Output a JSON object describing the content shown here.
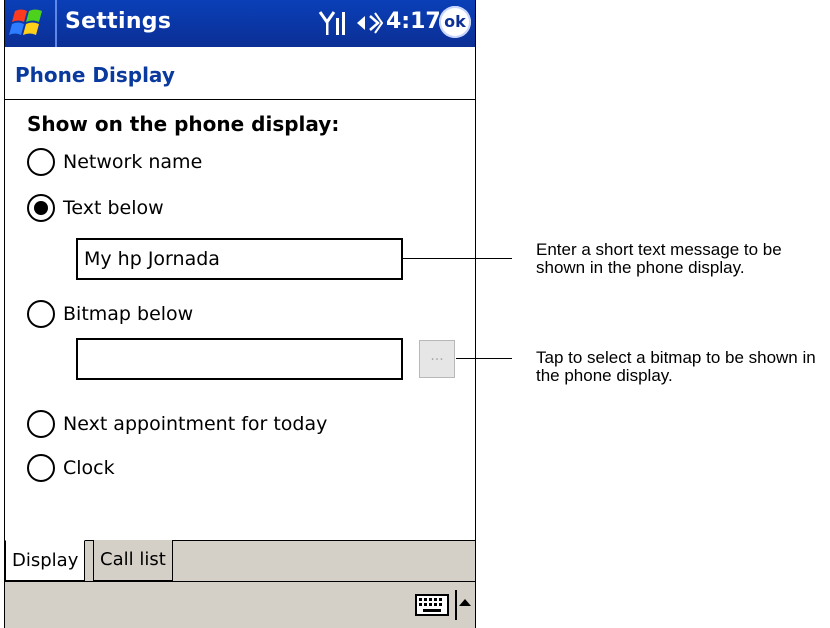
{
  "titlebar": {
    "title": "Settings",
    "time": "4:17",
    "ok_label": "ok",
    "icons": [
      "windows-start-icon",
      "signal-icon",
      "speaker-icon"
    ]
  },
  "page": {
    "title": "Phone Display"
  },
  "section": {
    "label": "Show on the phone display:"
  },
  "options": [
    {
      "label": "Network name",
      "selected": false
    },
    {
      "label": "Text below",
      "selected": true
    },
    {
      "label": "Bitmap below",
      "selected": false
    },
    {
      "label": "Next appointment for today",
      "selected": false
    },
    {
      "label": "Clock",
      "selected": false
    }
  ],
  "text_field": {
    "value": "My hp Jornada"
  },
  "bitmap_field": {
    "value": "",
    "browse_label": "..."
  },
  "tabs": [
    {
      "label": "Display",
      "active": true
    },
    {
      "label": "Call list",
      "active": false
    }
  ],
  "command_bar": {
    "icons": [
      "keyboard-icon",
      "sip-arrow-icon"
    ]
  },
  "callouts": [
    {
      "text": "Enter a short text message to be shown in the phone display."
    },
    {
      "text": "Tap to select a bitmap to be shown in the phone display."
    }
  ],
  "colors": {
    "titlebar": "#0b2f95",
    "page_title": "#0a3a9e",
    "bars": "#d4d0c8"
  }
}
